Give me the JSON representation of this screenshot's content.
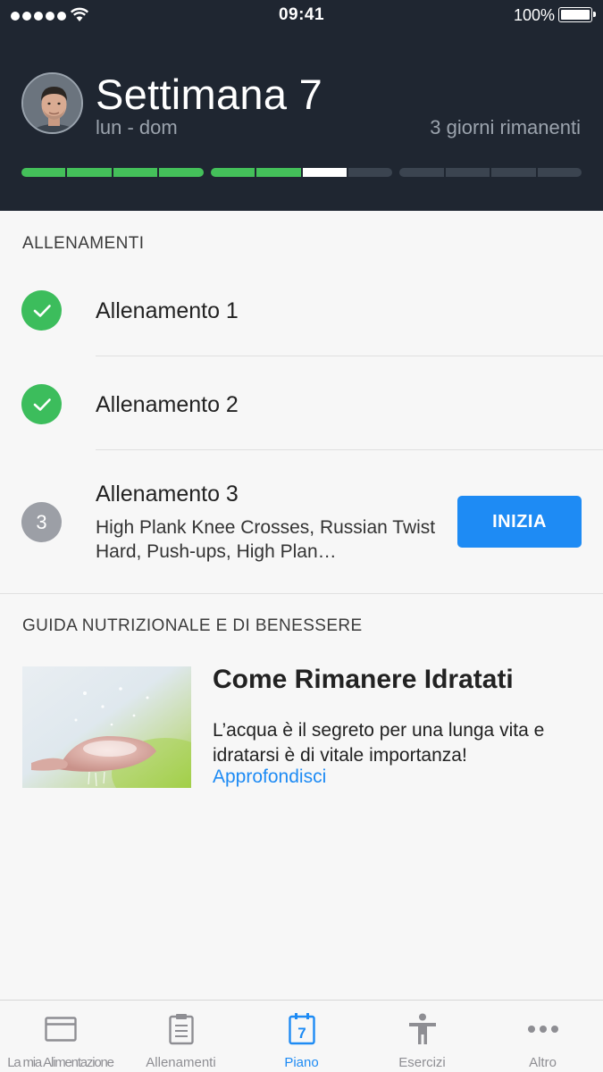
{
  "status_bar": {
    "time": "09:41",
    "battery": "100%"
  },
  "header": {
    "title": "Settimana 7",
    "range": "lun - dom",
    "days_left": "3 giorni rimanenti",
    "progress": {
      "groups": [
        [
          "done",
          "done",
          "done",
          "done"
        ],
        [
          "done",
          "done",
          "current",
          "todo"
        ],
        [
          "todo",
          "todo",
          "todo",
          "todo"
        ]
      ]
    }
  },
  "workouts": {
    "section_title": "ALLENAMENTI",
    "items": [
      {
        "name": "Allenamento 1",
        "completed": true
      },
      {
        "name": "Allenamento 2",
        "completed": true
      },
      {
        "number": "3",
        "name": "Allenamento 3",
        "completed": false,
        "description": "High Plank Knee Crosses, Russian Twist Hard, Push-ups, High Plan…"
      }
    ],
    "start_label": "INIZIA"
  },
  "guide": {
    "section_title": "GUIDA NUTRIZIONALE E DI BENESSERE",
    "title": "Come Rimanere Idratati",
    "text": "L’acqua è il segreto per una lunga vita e idratarsi è di vitale importanza!",
    "link": "Approfondisci"
  },
  "tabbar": {
    "items": [
      {
        "label": "La mia Alimentazione",
        "icon": "card-icon"
      },
      {
        "label": "Allenamenti",
        "icon": "clipboard-icon"
      },
      {
        "label": "Piano",
        "icon": "calendar-icon",
        "calendar_day": "7",
        "active": true
      },
      {
        "label": "Esercizi",
        "icon": "person-icon"
      },
      {
        "label": "Altro",
        "icon": "more-icon"
      }
    ]
  },
  "colors": {
    "accent": "#1e8bf4",
    "success": "#3cbd5c",
    "header_bg": "#1f2631"
  }
}
